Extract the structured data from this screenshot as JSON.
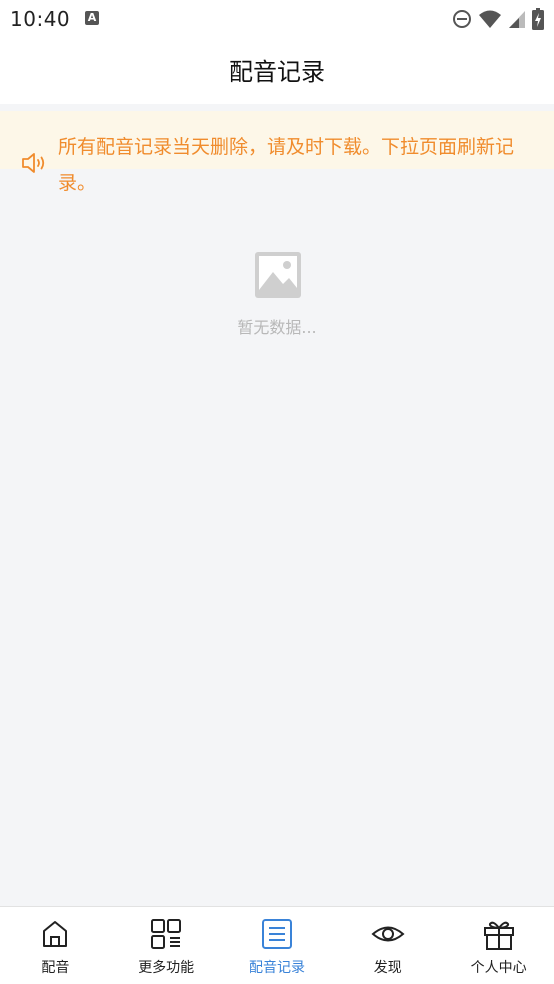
{
  "status_bar": {
    "time": "10:40",
    "notification_icon_letter": "A"
  },
  "header": {
    "title": "配音记录"
  },
  "notice": {
    "icon": "speaker-icon",
    "text": "所有配音记录当天删除，请及时下载。下拉页面刷新记录。",
    "color": "#f08c2d"
  },
  "empty_state": {
    "icon": "image-placeholder-icon",
    "text": "暂无数据..."
  },
  "tabbar": {
    "active_color": "#3a83d8",
    "tabs": [
      {
        "label": "配音",
        "icon": "home-icon"
      },
      {
        "label": "更多功能",
        "icon": "grid-icon"
      },
      {
        "label": "配音记录",
        "icon": "list-icon"
      },
      {
        "label": "发现",
        "icon": "eye-icon"
      },
      {
        "label": "个人中心",
        "icon": "gift-icon"
      }
    ]
  }
}
